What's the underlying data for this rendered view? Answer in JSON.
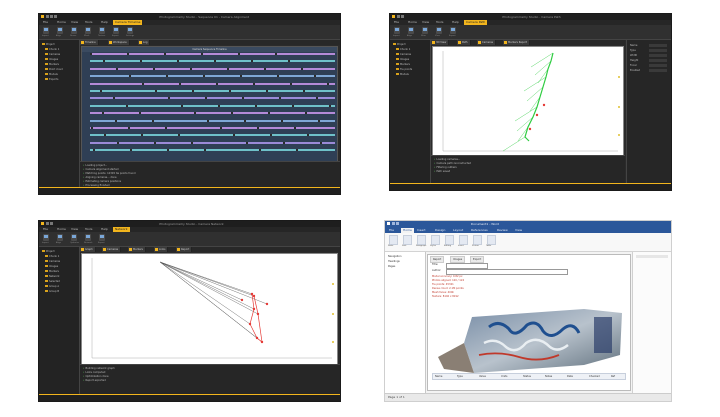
{
  "screens": [
    {
      "title": "Photogrammetry Studio - Sequence 01 - Camera Alignment",
      "tabs": [
        "File",
        "Home",
        "View",
        "Tools",
        "Help",
        "Camera Timeline"
      ],
      "active_tab": 5,
      "ribbon": [
        "Import",
        "Align",
        "Dense",
        "Mesh",
        "Texture",
        "Export",
        "Settings"
      ],
      "tree": [
        "Project",
        "Chunk 1",
        "Cameras",
        "Images",
        "Markers",
        "Point cloud",
        "Models",
        "Exports"
      ],
      "doc_tabs": [
        "Timeline",
        "Workspace",
        "Log"
      ],
      "plot_title": "Camera Sequence Timeline",
      "log": [
        "Loading project...",
        "Camera alignment started",
        "Matching points: 12345 tie points found",
        "Aligning cameras... done",
        "Estimating camera positions",
        "Processing finished"
      ]
    },
    {
      "title": "Photogrammetry Studio - Camera Path",
      "tabs": [
        "File",
        "Home",
        "View",
        "Tools",
        "Help",
        "Camera Path"
      ],
      "active_tab": 5,
      "ribbon": [
        "Import",
        "Align",
        "Filter",
        "View",
        "Export"
      ],
      "tree": [
        "Project",
        "Chunk 1",
        "Cameras",
        "Images",
        "Markers",
        "Tie points",
        "Models"
      ],
      "doc_tabs": [
        "3D View",
        "Path",
        "Cameras",
        "Markers Report"
      ],
      "properties": [
        "Name",
        "Type",
        "Width",
        "Height",
        "Focal",
        "Enabled"
      ],
      "log": [
        "Loading cameras...",
        "Camera path reconstructed",
        "Filtering outliers",
        "Path saved"
      ]
    },
    {
      "title": "Photogrammetry Studio - Camera Network",
      "tabs": [
        "File",
        "Home",
        "View",
        "Tools",
        "Help",
        "Network"
      ],
      "active_tab": 5,
      "ribbon": [
        "Import",
        "Align",
        "Optimize",
        "Network",
        "Export"
      ],
      "tree": [
        "Project",
        "Chunk 1",
        "Cameras",
        "Images",
        "Markers",
        "Network",
        "Selected",
        "Group A",
        "Group B"
      ],
      "doc_tabs": [
        "Graph",
        "Cameras",
        "Markers",
        "Links",
        "Report"
      ],
      "log": [
        "Building network graph",
        "Links computed",
        "Optimization done",
        "Report exported"
      ]
    },
    {
      "title": "Document1 - Word",
      "tabs": [
        "File",
        "Home",
        "Insert",
        "Design",
        "Layout",
        "References",
        "Review",
        "View"
      ],
      "active_tab": 1,
      "ribbon": [
        "Paste",
        "Font",
        "Paragraph",
        "Styles",
        "Editing",
        "Insert",
        "Picture",
        "Table"
      ],
      "tree": [
        "Navigation",
        "Headings",
        "Pages"
      ],
      "doc_tabs": [
        "Report",
        "Images",
        "Export"
      ],
      "fields": [
        "Title:",
        "Author:"
      ],
      "red_text": [
        "Model accuracy: 0.82 px",
        "Photos aligned: 120 / 124",
        "Tie points: 45321",
        "Dense cloud: 2.1M points",
        "Mesh faces: 400k",
        "Texture: 8192 x 8192"
      ],
      "table_headers": [
        "Name",
        "Type",
        "Value",
        "Units",
        "Status",
        "Notes",
        "Date",
        "Checked",
        "Ref"
      ],
      "status_text": "Page 1 of 1"
    }
  ],
  "colors": {
    "accent": "#f2b51d",
    "dark_bg": "#2b2b2b",
    "word_blue": "#2b579a",
    "path_green": "#2ecc40",
    "network_red": "#e53935"
  }
}
